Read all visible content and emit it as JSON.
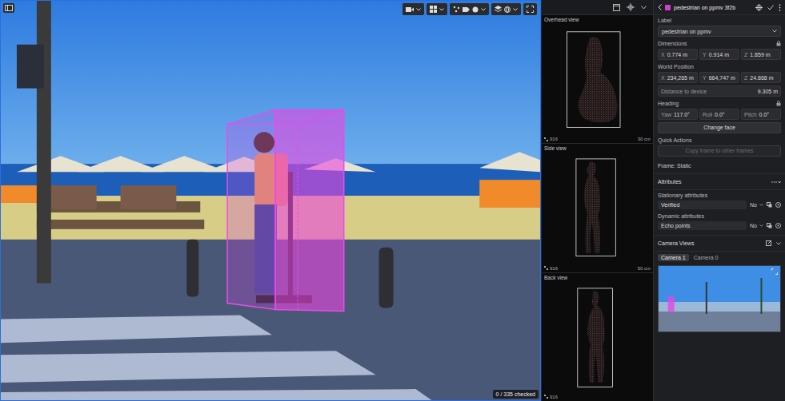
{
  "viewport": {
    "status": "0 / 335 checked"
  },
  "views": [
    {
      "title": "Overhead view",
      "scale": "30 cm",
      "points": "916"
    },
    {
      "title": "Side view",
      "scale": "50 cm",
      "points": "916"
    },
    {
      "title": "Back view",
      "scale": "",
      "points": "916"
    }
  ],
  "inspector": {
    "title": "pedestrian on ppmv 3f2b",
    "color": "#d63bd6",
    "label": {
      "heading": "Label",
      "value": "pedestrian on ppmv"
    },
    "dimensions": {
      "heading": "Dimensions",
      "locked": true,
      "fields": [
        {
          "axis": "X",
          "value": "0.774 m"
        },
        {
          "axis": "Y",
          "value": "0.914 m"
        },
        {
          "axis": "Z",
          "value": "1.859 m"
        }
      ]
    },
    "world_position": {
      "heading": "World Position",
      "locked": false,
      "fields": [
        {
          "axis": "X",
          "value": "234,265 m"
        },
        {
          "axis": "Y",
          "value": "664,747 m"
        },
        {
          "axis": "Z",
          "value": "24.868 m"
        }
      ],
      "distance_label": "Distance to device",
      "distance": "9.305 m"
    },
    "heading": {
      "heading": "Heading",
      "locked": true,
      "fields": [
        {
          "axis": "Yaw",
          "value": "117.0°"
        },
        {
          "axis": "Roll",
          "value": "0.0°"
        },
        {
          "axis": "Pitch",
          "value": "0.0°"
        }
      ],
      "button": "Change face"
    },
    "quick_actions": {
      "heading": "Quick Actions",
      "button": "Copy frame to other frames",
      "disabled": true
    },
    "frame": "Frame: Static",
    "attributes": {
      "heading": "Attributes",
      "expanded": true,
      "groups": [
        {
          "title": "Stationary attributes",
          "name": "Verified",
          "value": "No"
        },
        {
          "title": "Dynamic attributes",
          "name": "Echo points",
          "value": "No"
        }
      ]
    },
    "camera_views": {
      "heading": "Camera Views",
      "tabs": [
        {
          "label": "Camera 1",
          "selected": true
        },
        {
          "label": "Camera 0",
          "selected": false
        }
      ]
    }
  }
}
